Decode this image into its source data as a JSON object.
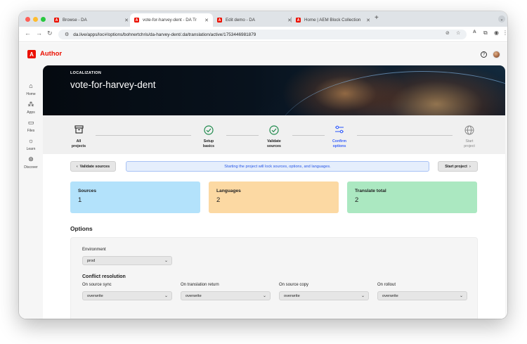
{
  "browser": {
    "tabs": [
      {
        "label": "Browse - DA",
        "active": false
      },
      {
        "label": "vote-for-harvey-dent - DA Tr",
        "active": true
      },
      {
        "label": "Edit demo - DA",
        "active": false
      },
      {
        "label": "Home | AEM Block Collection",
        "active": false
      }
    ],
    "url": "da.live/apps/loc#/options/bohnertchris/da-harvey-dent/.da/translation/active/1753446981879",
    "favicon_glyph": "A",
    "accent_color": "#eb1000"
  },
  "app": {
    "brand": "Author",
    "logo_glyph": "A",
    "nav": [
      {
        "label": "Home",
        "icon": "home-icon"
      },
      {
        "label": "Apps",
        "icon": "apps-icon"
      },
      {
        "label": "Files",
        "icon": "folder-icon"
      },
      {
        "label": "Learn",
        "icon": "lightbulb-icon"
      },
      {
        "label": "Discover",
        "icon": "compass-icon"
      }
    ]
  },
  "hero": {
    "eyebrow": "LOCALIZATION",
    "title": "vote-for-harvey-dent"
  },
  "steps": [
    {
      "label_1": "All",
      "label_2": "projects",
      "state": "done",
      "icon": "box-icon"
    },
    {
      "label_1": "Setup",
      "label_2": "basics",
      "state": "done",
      "icon": "check-circle-icon"
    },
    {
      "label_1": "Validate",
      "label_2": "sources",
      "state": "done",
      "icon": "check-circle-icon"
    },
    {
      "label_1": "Confirm",
      "label_2": "options",
      "state": "current",
      "icon": "sliders-icon"
    },
    {
      "label_1": "Start",
      "label_2": "project",
      "state": "future",
      "icon": "globe-icon"
    }
  ],
  "actions": {
    "back_label": "Validate sources",
    "notice": "Starting the project will lock sources, options, and languages.",
    "next_label": "Start project"
  },
  "summary": [
    {
      "title": "Sources",
      "value": "1",
      "color": "#b3e2fb"
    },
    {
      "title": "Languages",
      "value": "2",
      "color": "#fcd9a3"
    },
    {
      "title": "Translate total",
      "value": "2",
      "color": "#abe8c1"
    }
  ],
  "options": {
    "title": "Options",
    "environment_label": "Environment",
    "environment_value": "prod",
    "conflict_title": "Conflict resolution",
    "conflicts": [
      {
        "label": "On source sync",
        "value": "overwrite"
      },
      {
        "label": "On translation return",
        "value": "overwrite"
      },
      {
        "label": "On source copy",
        "value": "overwrite"
      },
      {
        "label": "On rollout",
        "value": "overwrite"
      }
    ]
  }
}
